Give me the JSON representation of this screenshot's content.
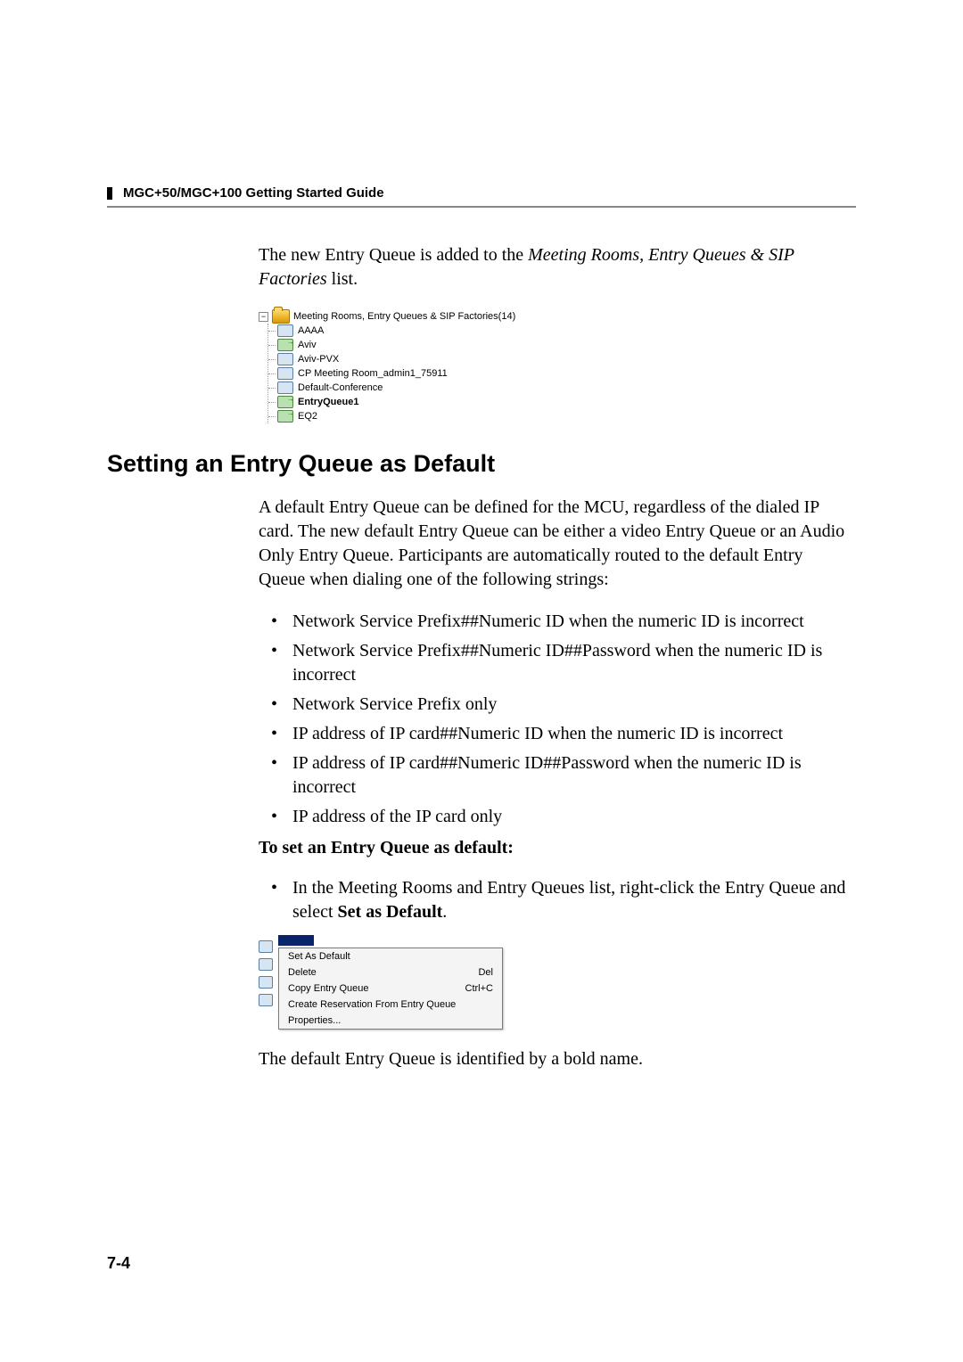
{
  "header": {
    "title": "MGC+50/MGC+100 Getting Started Guide"
  },
  "intro": {
    "pre": "The new Entry Queue is added to the ",
    "italic": "Meeting Rooms, Entry Queues & SIP Factories",
    "post": " list."
  },
  "tree": {
    "root": "Meeting Rooms, Entry Queues & SIP Factories(14)",
    "items": [
      {
        "label": "AAAA",
        "type": "room",
        "bold": false
      },
      {
        "label": "Aviv",
        "type": "eq",
        "bold": false
      },
      {
        "label": "Aviv-PVX",
        "type": "room",
        "bold": false
      },
      {
        "label": "CP Meeting Room_admin1_75911",
        "type": "room",
        "bold": false
      },
      {
        "label": "Default-Conference",
        "type": "room",
        "bold": false
      },
      {
        "label": "EntryQueue1",
        "type": "eq",
        "bold": true
      },
      {
        "label": "EQ2",
        "type": "eq",
        "bold": false
      }
    ]
  },
  "section": {
    "title": "Setting an Entry Queue as Default",
    "para": "A default Entry Queue can be defined for the MCU, regardless of the dialed IP card. The new default Entry Queue can be either a video Entry Queue or an Audio Only Entry Queue. Participants are automatically routed to the default Entry Queue when dialing one of the following strings:",
    "bullets": [
      "Network Service Prefix##Numeric ID when the numeric ID is incorrect",
      "Network Service Prefix##Numeric ID##Password when the numeric ID is incorrect",
      "Network Service Prefix only",
      "IP address of IP card##Numeric ID when the numeric ID is incorrect",
      "IP address of IP card##Numeric ID##Password when the numeric ID is incorrect",
      "IP address of the IP card only"
    ],
    "subhead": "To set an Entry Queue as default:",
    "step_pre": "In the Meeting Rooms and Entry Queues list, right-click the Entry Queue and select ",
    "step_bold": "Set as Default",
    "step_post": "."
  },
  "context_menu": {
    "items": [
      {
        "label": "Set As Default",
        "shortcut": ""
      },
      {
        "label": "Delete",
        "shortcut": "Del"
      },
      {
        "label": "Copy Entry Queue",
        "shortcut": "Ctrl+C"
      },
      {
        "label": "Create Reservation From Entry Queue",
        "shortcut": ""
      },
      {
        "label": "Properties...",
        "shortcut": ""
      }
    ]
  },
  "closing": "The default Entry Queue is identified by a bold name.",
  "page_number": "7-4"
}
